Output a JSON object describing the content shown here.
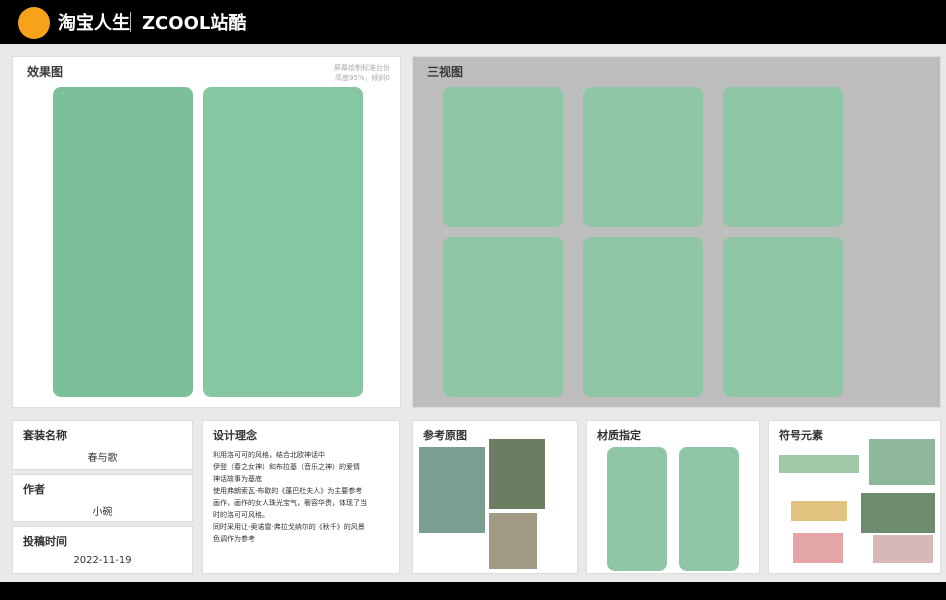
{
  "header": {
    "brand_left": "淘宝人生",
    "brand_right": "ZCOOL站酷"
  },
  "effect": {
    "title": "效果图",
    "note_line1": "屏幕绘制标准台份",
    "note_line2": "高度95%，倾斜0"
  },
  "three_view": {
    "title": "三视图"
  },
  "suit_name": {
    "title": "套装名称",
    "value": "春与歌"
  },
  "author": {
    "title": "作者",
    "value": "小碗"
  },
  "submit_time": {
    "title": "投稿时间",
    "value": "2022-11-19"
  },
  "design": {
    "title": "设计理念",
    "lines": [
      "利用洛可可的风格，结合北欧神话中",
      "伊登（春之女神）和布拉基（音乐之神）的爱情",
      "神话故事为基底",
      "使用弗朗索瓦·布歇的《蓬巴杜夫人》为主要参考",
      "画作，画作的女人珠光宝气，奢容华贵，体现了当",
      "时的洛可可风格。",
      "同时采用让-奥诺雷·弗拉戈纳尔的《秋千》的风景",
      "色调作为参考"
    ]
  },
  "reference": {
    "title": "参考原图"
  },
  "material": {
    "title": "材质指定"
  },
  "symbol": {
    "title": "符号元素"
  }
}
